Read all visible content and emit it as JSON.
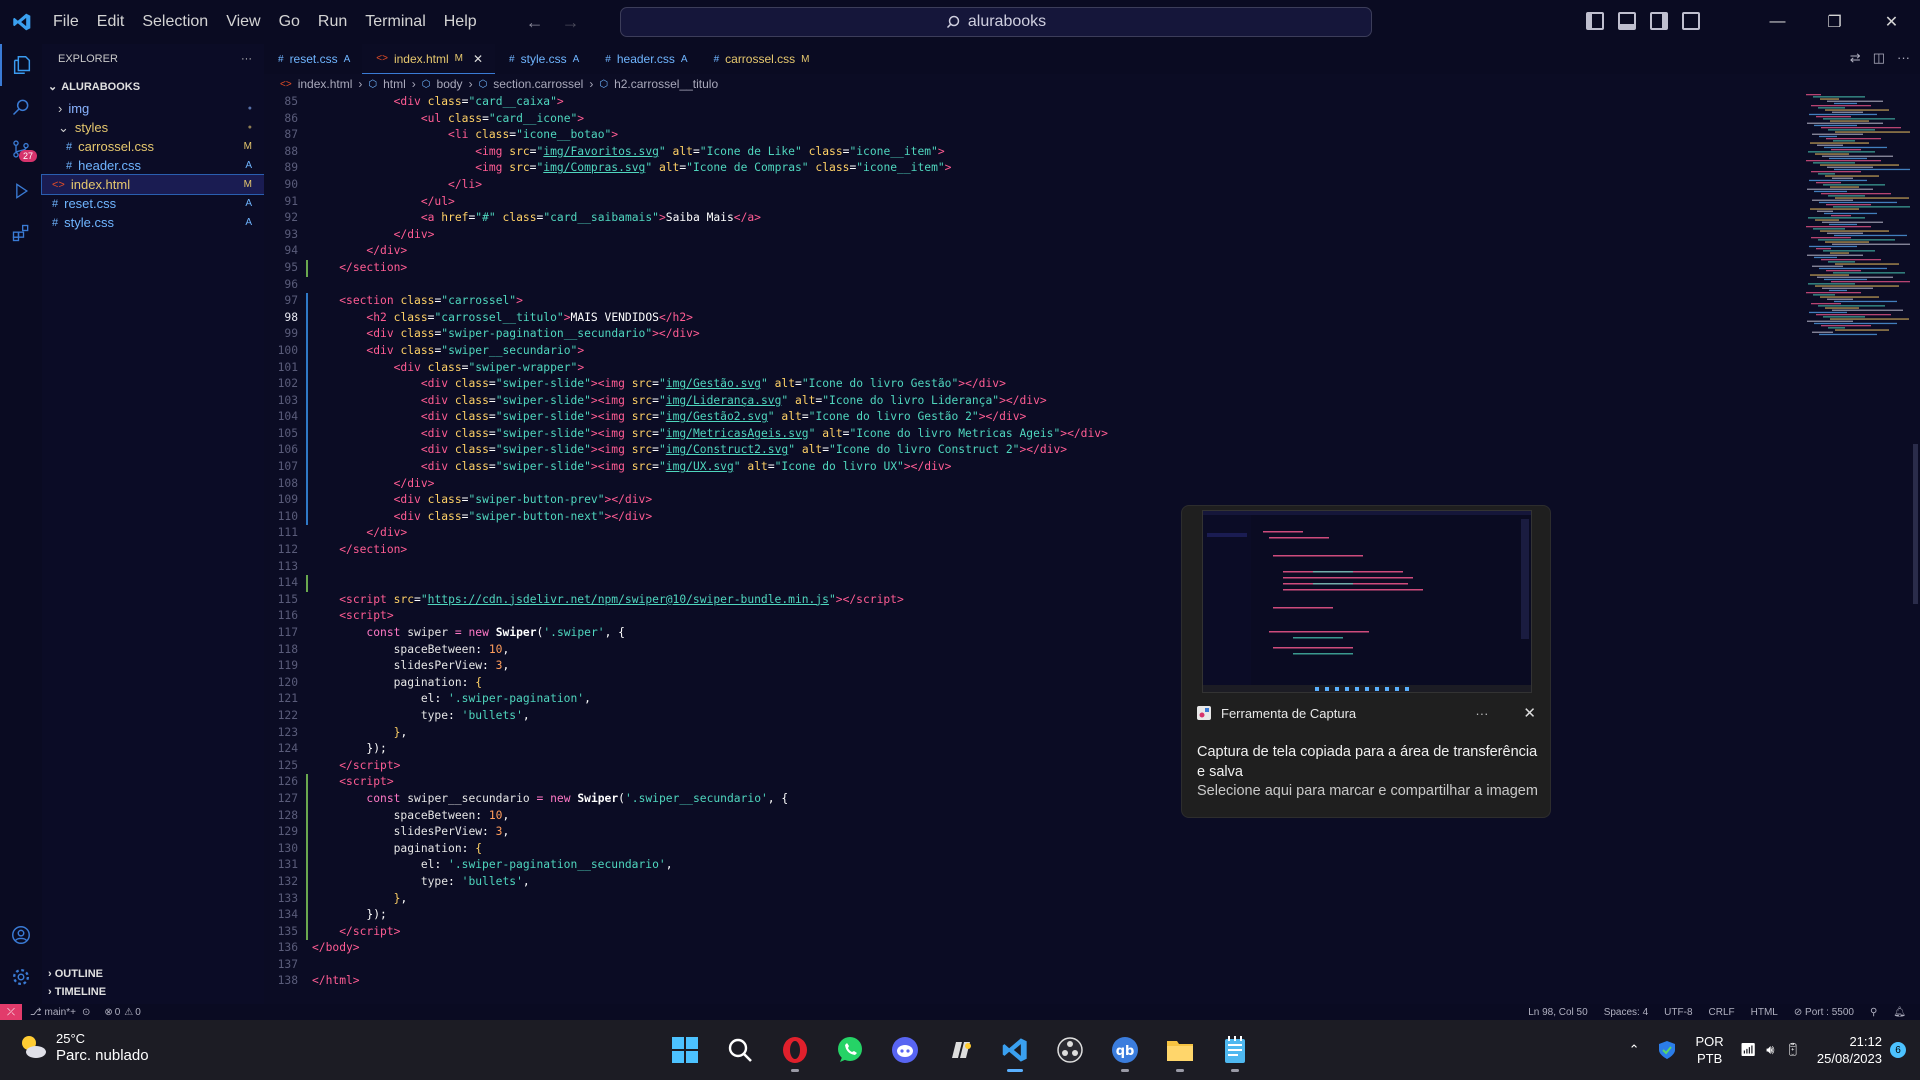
{
  "window": {
    "menu": [
      "File",
      "Edit",
      "Selection",
      "View",
      "Go",
      "Run",
      "Terminal",
      "Help"
    ],
    "search": "alurabooks"
  },
  "explorer": {
    "header": "EXPLORER",
    "root": "ALURABOOKS",
    "items": [
      {
        "name": "img",
        "status": "",
        "color": "#8ab4ff"
      },
      {
        "name": "styles",
        "status": "",
        "color": "#e6c86e"
      },
      {
        "name": "carrossel.css",
        "status": "M",
        "color": "#e6c86e"
      },
      {
        "name": "header.css",
        "status": "A",
        "color": "#6fb5ff"
      },
      {
        "name": "index.html",
        "status": "M",
        "color": "#e6c86e"
      },
      {
        "name": "reset.css",
        "status": "A",
        "color": "#6fb5ff"
      },
      {
        "name": "style.css",
        "status": "A",
        "color": "#6fb5ff"
      }
    ],
    "outline": "OUTLINE",
    "timeline": "TIMELINE"
  },
  "tabs": [
    {
      "name": "reset.css",
      "status": "A",
      "icon": "#",
      "color": "#6fb5ff"
    },
    {
      "name": "index.html",
      "status": "M",
      "icon": "<>",
      "color": "#e6c86e"
    },
    {
      "name": "style.css",
      "status": "A",
      "icon": "#",
      "color": "#6fb5ff"
    },
    {
      "name": "header.css",
      "status": "A",
      "icon": "#",
      "color": "#6fb5ff"
    },
    {
      "name": "carrossel.css",
      "status": "M",
      "icon": "#",
      "color": "#e6c86e"
    }
  ],
  "breadcrumb": [
    "index.html",
    "html",
    "body",
    "section.carrossel",
    "h2.carrossel__titulo"
  ],
  "code": [
    {
      "n": 85,
      "g": "",
      "h": "            <span class=t>&lt;div</span> <span class=a>class</span>=<span class=s>\"card__caixa\"</span><span class=t>&gt;</span>"
    },
    {
      "n": 86,
      "g": "",
      "h": "                <span class=t>&lt;ul</span> <span class=a>class</span>=<span class=s>\"card__icone\"</span><span class=t>&gt;</span>"
    },
    {
      "n": 87,
      "g": "",
      "h": "                    <span class=t>&lt;li</span> <span class=a>class</span>=<span class=s>\"icone__botao\"</span><span class=t>&gt;</span>"
    },
    {
      "n": 88,
      "g": "",
      "h": "                        <span class=t>&lt;img</span> <span class=a>src</span>=<span class=s>\"</span><span class=u>img/Favoritos.svg</span><span class=s>\"</span> <span class=a>alt</span>=<span class=s>\"Icone de Like\"</span> <span class=a>class</span>=<span class=s>\"icone__item\"</span><span class=t>&gt;</span>"
    },
    {
      "n": 89,
      "g": "",
      "h": "                        <span class=t>&lt;img</span> <span class=a>src</span>=<span class=s>\"</span><span class=u>img/Compras.svg</span><span class=s>\"</span> <span class=a>alt</span>=<span class=s>\"Icone de Compras\"</span> <span class=a>class</span>=<span class=s>\"icone__item\"</span><span class=t>&gt;</span>"
    },
    {
      "n": 90,
      "g": "",
      "h": "                    <span class=t>&lt;/li&gt;</span>"
    },
    {
      "n": 91,
      "g": "",
      "h": "                <span class=t>&lt;/ul&gt;</span>"
    },
    {
      "n": 92,
      "g": "",
      "h": "                <span class=t>&lt;a</span> <span class=a>href</span>=<span class=s>\"#\"</span> <span class=a>class</span>=<span class=s>\"card__saibamais\"</span><span class=t>&gt;</span>Saiba Mais<span class=t>&lt;/a&gt;</span>"
    },
    {
      "n": 93,
      "g": "",
      "h": "            <span class=t>&lt;/div&gt;</span>"
    },
    {
      "n": 94,
      "g": "",
      "h": "        <span class=t>&lt;/div&gt;</span>"
    },
    {
      "n": 95,
      "g": "add",
      "h": "    <span class=t>&lt;/section&gt;</span>"
    },
    {
      "n": 96,
      "g": "",
      "h": ""
    },
    {
      "n": 97,
      "g": "mod",
      "h": "    <span class=t>&lt;section</span> <span class=a>class</span>=<span class=s>\"carrossel\"</span><span class=t>&gt;</span>"
    },
    {
      "n": 98,
      "g": "mod",
      "h": "        <span class=t>&lt;h2</span> <span class=a>class</span>=<span class=s>\"carrossel__titulo\"</span><span class=t>&gt;</span>MAIS VENDIDOS<span class=t>&lt;/h2&gt;</span>",
      "cur": true
    },
    {
      "n": 99,
      "g": "mod",
      "h": "        <span class=t>&lt;div</span> <span class=a>class</span>=<span class=s>\"swiper-pagination__secundario\"</span><span class=t>&gt;&lt;/div&gt;</span>"
    },
    {
      "n": 100,
      "g": "mod",
      "h": "        <span class=t>&lt;div</span> <span class=a>class</span>=<span class=s>\"swiper__secundario\"</span><span class=t>&gt;</span>"
    },
    {
      "n": 101,
      "g": "mod",
      "h": "            <span class=t>&lt;div</span> <span class=a>class</span>=<span class=s>\"swiper-wrapper\"</span><span class=t>&gt;</span>"
    },
    {
      "n": 102,
      "g": "mod",
      "h": "                <span class=t>&lt;div</span> <span class=a>class</span>=<span class=s>\"swiper-slide\"</span><span class=t>&gt;&lt;img</span> <span class=a>src</span>=<span class=s>\"</span><span class=u>img/Gestão.svg</span><span class=s>\"</span> <span class=a>alt</span>=<span class=s>\"Icone do livro Gestão\"</span><span class=t>&gt;&lt;/div&gt;</span>"
    },
    {
      "n": 103,
      "g": "mod",
      "h": "                <span class=t>&lt;div</span> <span class=a>class</span>=<span class=s>\"swiper-slide\"</span><span class=t>&gt;&lt;img</span> <span class=a>src</span>=<span class=s>\"</span><span class=u>img/Liderança.svg</span><span class=s>\"</span> <span class=a>alt</span>=<span class=s>\"Icone do livro Liderança\"</span><span class=t>&gt;&lt;/div&gt;</span>"
    },
    {
      "n": 104,
      "g": "mod",
      "h": "                <span class=t>&lt;div</span> <span class=a>class</span>=<span class=s>\"swiper-slide\"</span><span class=t>&gt;&lt;img</span> <span class=a>src</span>=<span class=s>\"</span><span class=u>img/Gestão2.svg</span><span class=s>\"</span> <span class=a>alt</span>=<span class=s>\"Icone do livro Gestão 2\"</span><span class=t>&gt;&lt;/div&gt;</span>"
    },
    {
      "n": 105,
      "g": "mod",
      "h": "                <span class=t>&lt;div</span> <span class=a>class</span>=<span class=s>\"swiper-slide\"</span><span class=t>&gt;&lt;img</span> <span class=a>src</span>=<span class=s>\"</span><span class=u>img/MetricasAgeis.svg</span><span class=s>\"</span> <span class=a>alt</span>=<span class=s>\"Icone do livro Metricas Ageis\"</span><span class=t>&gt;&lt;/div&gt;</span>"
    },
    {
      "n": 106,
      "g": "mod",
      "h": "                <span class=t>&lt;div</span> <span class=a>class</span>=<span class=s>\"swiper-slide\"</span><span class=t>&gt;&lt;img</span> <span class=a>src</span>=<span class=s>\"</span><span class=u>img/Construct2.svg</span><span class=s>\"</span> <span class=a>alt</span>=<span class=s>\"Icone do livro Construct 2\"</span><span class=t>&gt;&lt;/div&gt;</span>"
    },
    {
      "n": 107,
      "g": "mod",
      "h": "                <span class=t>&lt;div</span> <span class=a>class</span>=<span class=s>\"swiper-slide\"</span><span class=t>&gt;&lt;img</span> <span class=a>src</span>=<span class=s>\"</span><span class=u>img/UX.svg</span><span class=s>\"</span> <span class=a>alt</span>=<span class=s>\"Icone do livro UX\"</span><span class=t>&gt;&lt;/div&gt;</span>"
    },
    {
      "n": 108,
      "g": "mod",
      "h": "            <span class=t>&lt;/div&gt;</span>"
    },
    {
      "n": 109,
      "g": "mod",
      "h": "            <span class=t>&lt;div</span> <span class=a>class</span>=<span class=s>\"swiper-button-prev\"</span><span class=t>&gt;&lt;/div&gt;</span>"
    },
    {
      "n": 110,
      "g": "mod",
      "h": "            <span class=t>&lt;div</span> <span class=a>class</span>=<span class=s>\"swiper-button-next\"</span><span class=t>&gt;&lt;/div&gt;</span>"
    },
    {
      "n": 111,
      "g": "",
      "h": "        <span class=t>&lt;/div&gt;</span>"
    },
    {
      "n": 112,
      "g": "",
      "h": "    <span class=t>&lt;/section&gt;</span>"
    },
    {
      "n": 113,
      "g": "",
      "h": ""
    },
    {
      "n": 114,
      "g": "add",
      "h": ""
    },
    {
      "n": 115,
      "g": "",
      "h": "    <span class=t>&lt;script</span> <span class=a>src</span>=<span class=s>\"</span><span class=u>https://cdn.jsdelivr.net/npm/swiper@10/swiper-bundle.min.js</span><span class=s>\"</span><span class=t>&gt;&lt;/script&gt;</span>"
    },
    {
      "n": 116,
      "g": "",
      "h": "    <span class=t>&lt;script&gt;</span>"
    },
    {
      "n": 117,
      "g": "",
      "h": "        <span class=k>const</span> <span class=p>swiper</span> <span class=k>=</span> <span class=k>new</span> <span class=f>Swiper</span>(<span class=s>'.swiper'</span>, {"
    },
    {
      "n": 118,
      "g": "",
      "h": "            <span class=p>spaceBetween</span>: <span class=n>10</span>,"
    },
    {
      "n": 119,
      "g": "",
      "h": "            <span class=p>slidesPerView</span>: <span class=n>3</span>,"
    },
    {
      "n": 120,
      "g": "",
      "h": "            <span class=p>pagination</span>: <span class=sp>{</span>"
    },
    {
      "n": 121,
      "g": "",
      "h": "                <span class=p>el</span>: <span class=s>'.swiper-pagination'</span>,"
    },
    {
      "n": 122,
      "g": "",
      "h": "                <span class=p>type</span>: <span class=s>'bullets'</span>,"
    },
    {
      "n": 123,
      "g": "",
      "h": "            <span class=sp>}</span>,"
    },
    {
      "n": 124,
      "g": "",
      "h": "        });"
    },
    {
      "n": 125,
      "g": "",
      "h": "    <span class=t>&lt;/script&gt;</span>"
    },
    {
      "n": 126,
      "g": "add",
      "h": "    <span class=t>&lt;script&gt;</span>"
    },
    {
      "n": 127,
      "g": "add",
      "h": "        <span class=k>const</span> <span class=p>swiper__secundario</span> <span class=k>=</span> <span class=k>new</span> <span class=f>Swiper</span>(<span class=s>'.swiper__secundario'</span>, {"
    },
    {
      "n": 128,
      "g": "add",
      "h": "            <span class=p>spaceBetween</span>: <span class=n>10</span>,"
    },
    {
      "n": 129,
      "g": "add",
      "h": "            <span class=p>slidesPerView</span>: <span class=n>3</span>,"
    },
    {
      "n": 130,
      "g": "add",
      "h": "            <span class=p>pagination</span>: <span class=sp>{</span>"
    },
    {
      "n": 131,
      "g": "add",
      "h": "                <span class=p>el</span>: <span class=s>'.swiper-pagination__secundario'</span>,"
    },
    {
      "n": 132,
      "g": "add",
      "h": "                <span class=p>type</span>: <span class=s>'bullets'</span>,"
    },
    {
      "n": 133,
      "g": "add",
      "h": "            <span class=sp>}</span>,"
    },
    {
      "n": 134,
      "g": "add",
      "h": "        });"
    },
    {
      "n": 135,
      "g": "add",
      "h": "    <span class=t>&lt;/script&gt;</span>"
    },
    {
      "n": 136,
      "g": "",
      "h": "<span class=t>&lt;/body&gt;</span>"
    },
    {
      "n": 137,
      "g": "",
      "h": ""
    },
    {
      "n": 138,
      "g": "",
      "h": "<span class=t>&lt;/html&gt;</span>"
    }
  ],
  "notification": {
    "app": "Ferramenta de Captura",
    "message": "Captura de tela copiada para a área de transferência e salva",
    "sub": "Selecione aqui para marcar e compartilhar a imagem"
  },
  "status": {
    "branch": "main*+",
    "problems": "0",
    "warnings": "0",
    "position": "Ln 98, Col 50",
    "spaces": "Spaces: 4",
    "encoding": "UTF-8",
    "eol": "CRLF",
    "language": "HTML",
    "port": "Port : 5500"
  },
  "taskbar": {
    "temp": "25°C",
    "weather": "Parc. nublado",
    "lang1": "POR",
    "lang2": "PTB",
    "time": "21:12",
    "date": "25/08/2023",
    "notif_count": "6"
  },
  "colors": {
    "accent": "#3a7bd5",
    "modified": "#e6c86e",
    "added": "#6fb5ff"
  }
}
